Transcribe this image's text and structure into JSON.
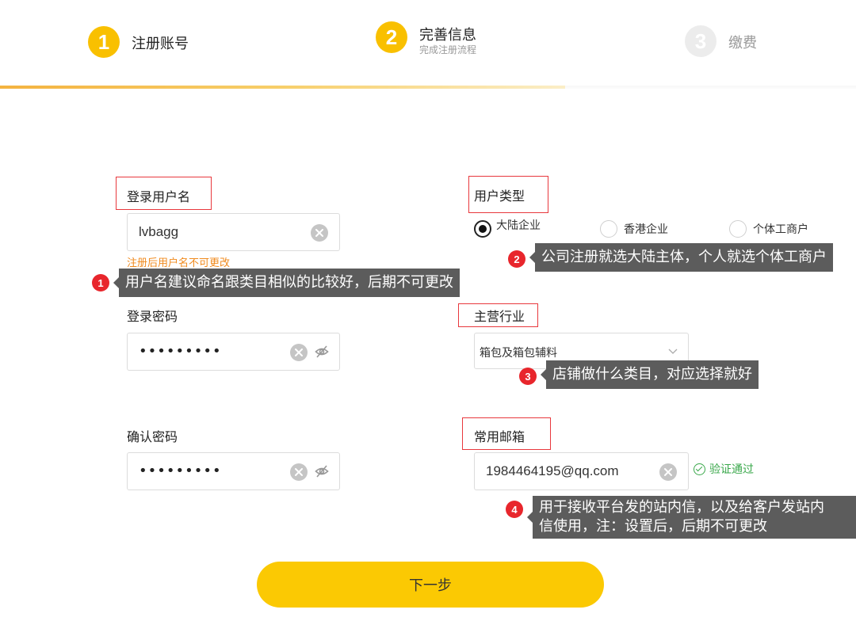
{
  "steps": [
    {
      "number": "1",
      "title": "注册账号",
      "subtitle": ""
    },
    {
      "number": "2",
      "title": "完善信息",
      "subtitle": "完成注册流程"
    },
    {
      "number": "3",
      "title": "缴费",
      "subtitle": ""
    }
  ],
  "progress": {
    "completed_fraction": 0.66
  },
  "form": {
    "username": {
      "label": "登录用户名",
      "value": "lvbagg",
      "hint": "注册后用户名不可更改"
    },
    "user_type": {
      "label": "用户类型",
      "options": [
        "大陆企业",
        "香港企业",
        "个体工商户"
      ],
      "selected": "大陆企业"
    },
    "password": {
      "label": "登录密码",
      "value": "•••••••••"
    },
    "industry": {
      "label": "主营行业",
      "value": "箱包及箱包辅料"
    },
    "confirm_password": {
      "label": "确认密码",
      "value": "•••••••••"
    },
    "email": {
      "label": "常用邮箱",
      "value": "1984464195@qq.com",
      "status": "验证通过"
    }
  },
  "annotations": [
    {
      "number": "1",
      "text": "用户名建议命名跟类目相似的比较好，后期不可更改"
    },
    {
      "number": "2",
      "text": "公司注册就选大陆主体，个人就选个体工商户"
    },
    {
      "number": "3",
      "text": "店铺做什么类目，对应选择就好"
    },
    {
      "number": "4",
      "line1": "用于接收平台发的站内信，以及给客户发站内",
      "line2": "信使用，注：设置后，后期不可更改"
    }
  ],
  "next_button": "下一步",
  "colors": {
    "accent": "#fbc903",
    "annotation_red": "#e8262c",
    "hint_orange": "#f08a1d",
    "success_green": "#3aa84b"
  }
}
